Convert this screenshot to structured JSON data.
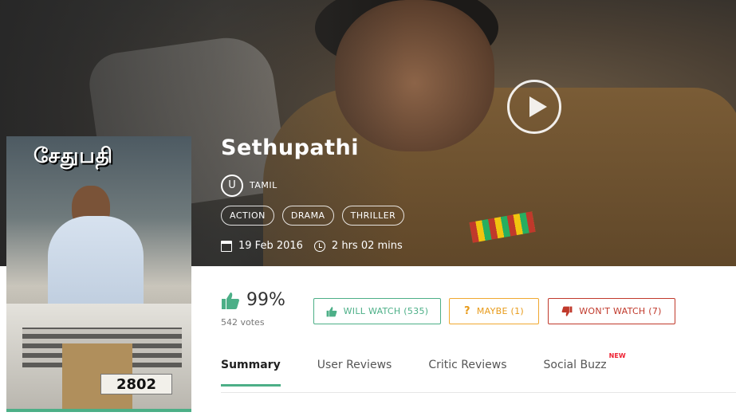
{
  "movie": {
    "title": "Sethupathi",
    "poster_title": "சேதுபதி",
    "poster_plate": "2802",
    "certificate": "U",
    "language": "TAMIL",
    "genres": [
      "ACTION",
      "DRAMA",
      "THRILLER"
    ],
    "release_date": "19 Feb 2016",
    "duration": "2 hrs 02 mins"
  },
  "rating": {
    "percent": "99%",
    "votes": "542 votes"
  },
  "vote_buttons": {
    "will_watch": "WILL WATCH (535)",
    "maybe": "MAYBE (1)",
    "wont_watch": "WON'T WATCH (7)"
  },
  "tabs": [
    {
      "label": "Summary",
      "active": true
    },
    {
      "label": "User Reviews"
    },
    {
      "label": "Critic Reviews"
    },
    {
      "label": "Social Buzz",
      "badge": "NEW"
    }
  ],
  "colors": {
    "accent": "#4caf87",
    "maybe": "#e89b1a",
    "wont": "#c0392b"
  }
}
